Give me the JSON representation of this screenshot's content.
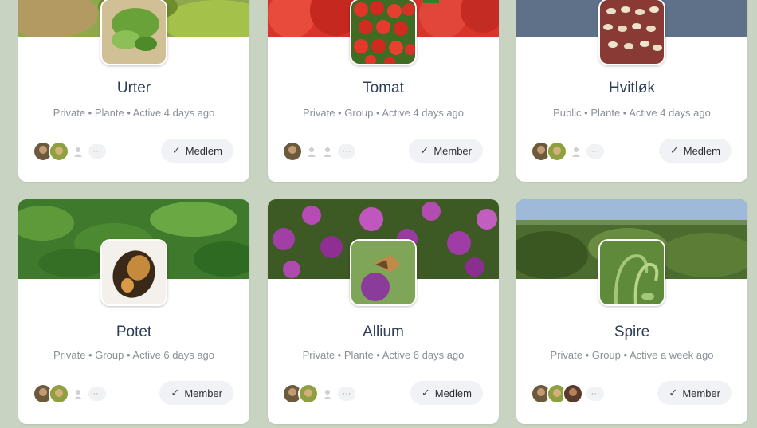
{
  "groups": [
    {
      "name": "Urter",
      "meta": "Private • Plante • Active 4 days ago",
      "button": "Medlem",
      "check": "✓",
      "more": "···"
    },
    {
      "name": "Tomat",
      "meta": "Private • Group • Active 4 days ago",
      "button": "Member",
      "check": "✓",
      "more": "···"
    },
    {
      "name": "Hvitløk",
      "meta": "Public • Plante • Active 4 days ago",
      "button": "Medlem",
      "check": "✓",
      "more": "···"
    },
    {
      "name": "Potet",
      "meta": "Private • Group • Active 6 days ago",
      "button": "Member",
      "check": "✓",
      "more": "···"
    },
    {
      "name": "Allium",
      "meta": "Private • Plante • Active 6 days ago",
      "button": "Medlem",
      "check": "✓",
      "more": "···"
    },
    {
      "name": "Spire",
      "meta": "Private • Group • Active a week ago",
      "button": "Member",
      "check": "✓",
      "more": "···"
    }
  ],
  "colors": {
    "background": "#c9d3c2",
    "card": "#ffffff",
    "title": "#2c3e57",
    "meta": "#8b9098",
    "button_bg": "#f0f2f5"
  },
  "icons": [
    "check-icon",
    "person-placeholder-icon",
    "more-icon"
  ]
}
